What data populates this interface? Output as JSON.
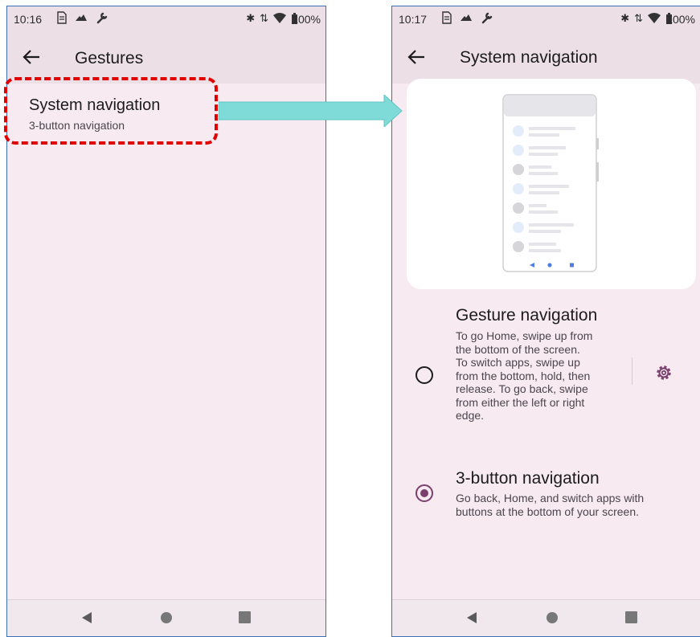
{
  "left_screen": {
    "status": {
      "time": "10:16",
      "battery": "100%"
    },
    "header": {
      "title": "Gestures"
    },
    "item": {
      "title": "System navigation",
      "subtitle": "3-button navigation"
    }
  },
  "right_screen": {
    "status": {
      "time": "10:17",
      "battery": "100%"
    },
    "header": {
      "title": "System navigation"
    },
    "options": [
      {
        "title": "Gesture navigation",
        "lines": [
          "To go Home, swipe up from",
          "the bottom of the screen.",
          "To switch apps, swipe up",
          "from the bottom, hold, then",
          "release. To go back, swipe",
          "from either the left or right",
          "edge."
        ],
        "selected": false
      },
      {
        "title": "3-button navigation",
        "lines": [
          "Go back, Home, and switch apps with",
          "buttons at the bottom of your screen."
        ],
        "selected": true
      }
    ]
  },
  "icons": {
    "status": [
      "sim-icon",
      "cloud-icon",
      "wrench-icon",
      "bluetooth-icon",
      "data-arrows-icon",
      "wifi-icon",
      "battery-icon"
    ],
    "nav": [
      "back-triangle-icon",
      "home-circle-icon",
      "recents-square-icon"
    ],
    "settings": "gear-icon"
  },
  "colors": {
    "accent": "#7b3f6e",
    "highlight": "#e00000",
    "arrow": "#7fdbd8",
    "background": "#f7eaf0",
    "appbar": "#ece0e6"
  }
}
